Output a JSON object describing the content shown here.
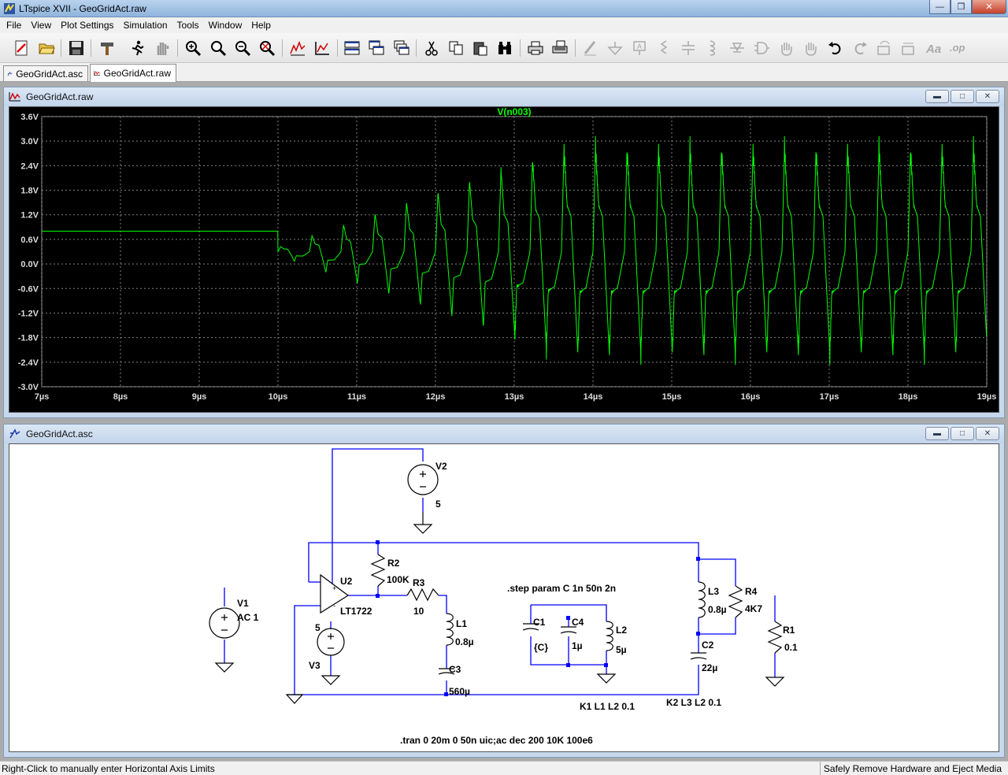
{
  "window": {
    "title": "LTspice XVII - GeoGridAct.raw"
  },
  "menu": [
    {
      "label": "File"
    },
    {
      "label": "View"
    },
    {
      "label": "Plot Settings"
    },
    {
      "label": "Simulation"
    },
    {
      "label": "Tools"
    },
    {
      "label": "Window"
    },
    {
      "label": "Help"
    }
  ],
  "tabs": [
    {
      "label": "GeoGridAct.asc",
      "icon": "schematic-icon"
    },
    {
      "label": "GeoGridAct.raw",
      "icon": "waveform-icon"
    }
  ],
  "plot_window": {
    "title": "GeoGridAct.raw",
    "icon": "waveform-icon"
  },
  "schematic_window": {
    "title": "GeoGridAct.asc",
    "icon": "schematic-icon"
  },
  "status": {
    "left": "Right-Click to manually enter Horizontal Axis Limits",
    "right": "Safely Remove Hardware and Eject Media"
  },
  "colors": {
    "trace": "#00ff00",
    "plot_bg": "#000000",
    "wire": "#0000ff",
    "grid": "#7f7f7f"
  },
  "chart_data": {
    "type": "line",
    "title": "V(n003)",
    "series": [
      {
        "name": "V(n003)"
      }
    ],
    "xlabel": "",
    "ylabel": "",
    "x_ticks": [
      "7µs",
      "8µs",
      "9µs",
      "10µs",
      "11µs",
      "12µs",
      "13µs",
      "14µs",
      "15µs",
      "16µs",
      "17µs",
      "18µs",
      "19µs"
    ],
    "y_ticks": [
      "3.6V",
      "3.0V",
      "2.4V",
      "1.8V",
      "1.2V",
      "0.6V",
      "0.0V",
      "-0.6V",
      "-1.2V",
      "-1.8V",
      "-2.4V",
      "-3.0V"
    ],
    "xlim": [
      7,
      19
    ],
    "x_unit": "µs",
    "ylim": [
      -3.0,
      3.6
    ],
    "y_unit": "V",
    "grid": true,
    "waveform": {
      "description_points_us_V": [
        [
          7.0,
          0.81
        ],
        [
          8.0,
          0.8
        ],
        [
          9.0,
          0.79
        ],
        [
          10.0,
          0.78
        ],
        [
          10.3,
          0.8
        ],
        [
          10.55,
          0.9
        ],
        [
          10.8,
          0.5
        ],
        [
          11.0,
          0.95
        ],
        [
          11.2,
          0.35
        ],
        [
          11.35,
          1.1
        ],
        [
          11.6,
          -0.1
        ],
        [
          11.75,
          1.3
        ],
        [
          12.0,
          -0.55
        ],
        [
          12.15,
          1.55
        ],
        [
          12.4,
          -0.85
        ],
        [
          12.6,
          1.75
        ],
        [
          12.8,
          -1.3
        ],
        [
          13.0,
          2.15
        ],
        [
          13.2,
          -2.0
        ],
        [
          13.4,
          2.35
        ],
        [
          13.6,
          -2.3
        ],
        [
          13.8,
          2.45
        ],
        [
          14.0,
          -2.45
        ],
        [
          14.2,
          2.55
        ],
        [
          14.4,
          -2.45
        ],
        [
          14.6,
          2.55
        ],
        [
          14.8,
          -2.4
        ],
        [
          15.0,
          2.65
        ],
        [
          15.2,
          -2.45
        ],
        [
          15.4,
          2.55
        ],
        [
          15.6,
          -2.45
        ],
        [
          15.8,
          2.6
        ],
        [
          16.0,
          -2.45
        ],
        [
          16.2,
          2.6
        ],
        [
          16.4,
          -2.4
        ],
        [
          16.6,
          2.55
        ],
        [
          16.8,
          -2.45
        ],
        [
          17.0,
          2.6
        ],
        [
          17.2,
          -2.45
        ],
        [
          17.4,
          2.55
        ],
        [
          17.6,
          -2.4
        ],
        [
          17.8,
          2.6
        ],
        [
          18.0,
          -2.45
        ],
        [
          18.2,
          2.6
        ],
        [
          18.4,
          -2.45
        ],
        [
          18.6,
          2.55
        ],
        [
          18.9,
          2.7
        ],
        [
          19.0,
          0.85
        ]
      ]
    }
  },
  "schematic": {
    "labels": {
      "v2": "V2",
      "v2_val": "5",
      "r2": "R2",
      "r2_val": "100K",
      "r3": "R3",
      "r3_val": "10",
      "u2": "U2",
      "u2_val": "LT1722",
      "v1": "V1",
      "v1_val": "AC 1",
      "v3": "V3",
      "v3_val": "5",
      "l1": "L1",
      "l1_val": "0.8µ",
      "c3": "C3",
      "c3_val": "560µ",
      "c1": "C1",
      "c1_val": "{C}",
      "c4": "C4",
      "c4_val": "1µ",
      "l2": "L2",
      "l2_val": "5µ",
      "l3": "L3",
      "l3_val": "0.8µ",
      "r4": "R4",
      "r4_val": "4K7",
      "c2": "C2",
      "c2_val": "22µ",
      "r1": "R1",
      "r1_val": "0.1"
    },
    "directives": {
      "step": ".step param C 1n 50n 2n",
      "k1": "K1 L1 L2 0.1",
      "k2": "K2 L3 L2 0.1",
      "tran": ".tran 0 20m 0 50n uic;ac dec 200 10K 100e6"
    }
  }
}
